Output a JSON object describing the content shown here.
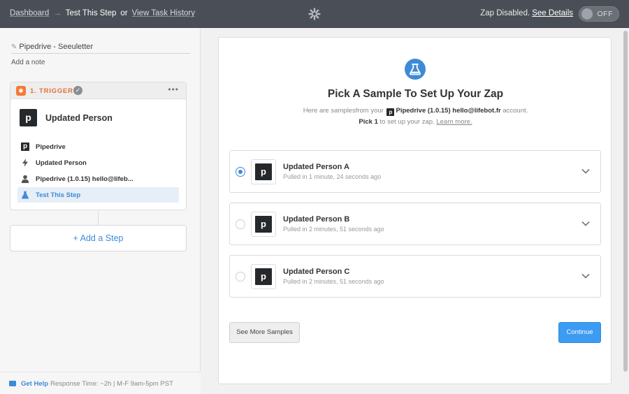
{
  "topbar": {
    "dashboard": "Dashboard",
    "arrow": "→",
    "current": "Test This Step",
    "or": "or",
    "history": "View Task History",
    "status": "Zap Disabled.",
    "see_details": "See Details",
    "toggle": "OFF"
  },
  "sidebar": {
    "zap_name": "Pipedrive - Seeuletter",
    "add_note": "Add a note",
    "trigger": {
      "label": "1. TRIGGER",
      "app_title": "Updated Person",
      "rows": [
        {
          "icon": "pipedrive-icon",
          "label": "Pipedrive"
        },
        {
          "icon": "bolt-icon",
          "label": "Updated Person"
        },
        {
          "icon": "user-icon",
          "label": "Pipedrive (1.0.15) hello@lifeb..."
        },
        {
          "icon": "flask-icon",
          "label": "Test This Step"
        }
      ]
    },
    "add_step": "+ Add a Step",
    "help": {
      "label": "Get Help",
      "meta": "Response Time: ~2h | M-F 9am-5pm PST"
    }
  },
  "main": {
    "title": "Pick A Sample To Set Up Your Zap",
    "sub_prefix": "Here are samplesfrom your",
    "sub_account": "Pipedrive (1.0.15) hello@lifebot.fr",
    "sub_suffix": "account.",
    "pick": "Pick 1",
    "pick_suffix": "to set up your zap.",
    "learn_more": "Learn more.",
    "samples": [
      {
        "name": "Updated Person A",
        "meta": "Pulled in 1 minute, 24 seconds ago",
        "selected": true
      },
      {
        "name": "Updated Person B",
        "meta": "Pulled in 2 minutes, 51 seconds ago",
        "selected": false
      },
      {
        "name": "Updated Person C",
        "meta": "Pulled in 2 minutes, 51 seconds ago",
        "selected": false
      }
    ],
    "see_more": "See More Samples",
    "continue": "Continue"
  },
  "colors": {
    "accent": "#3d8bd7",
    "topbar": "#4a4f57",
    "trigger": "#f47a36",
    "pipedrive": "#26292c"
  },
  "pipedrive_letter": "p"
}
